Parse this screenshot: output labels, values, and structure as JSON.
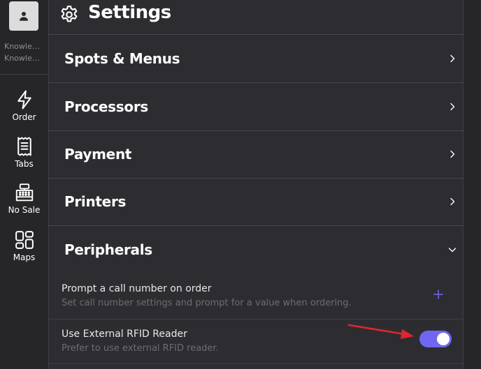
{
  "sidebar": {
    "user": {
      "line1": "Knowledge Base",
      "line2": "Knowledge Base"
    },
    "items": [
      {
        "label": "Order",
        "icon": "lightning-icon"
      },
      {
        "label": "Tabs",
        "icon": "receipt-icon"
      },
      {
        "label": "No Sale",
        "icon": "cash-register-icon"
      },
      {
        "label": "Maps",
        "icon": "layout-grid-icon"
      }
    ]
  },
  "header": {
    "title": "Settings",
    "icon": "gear-icon"
  },
  "sections": [
    {
      "label": "Spots & Menus",
      "expanded": false
    },
    {
      "label": "Processors",
      "expanded": false
    },
    {
      "label": "Payment",
      "expanded": false
    },
    {
      "label": "Printers",
      "expanded": false
    },
    {
      "label": "Peripherals",
      "expanded": true
    }
  ],
  "peripherals": {
    "settings": [
      {
        "title": "Prompt a call number on order",
        "subtitle": "Set call number settings and prompt for a value when ordering.",
        "control": "add"
      },
      {
        "title": "Use External RFID Reader",
        "subtitle": "Prefer to use external RFID reader.",
        "control": "toggle",
        "enabled": true
      }
    ]
  },
  "colors": {
    "accent": "#6f67f0",
    "annotation_arrow": "#e0262b",
    "background": "#2d2d31",
    "sidebar": "#262629"
  }
}
